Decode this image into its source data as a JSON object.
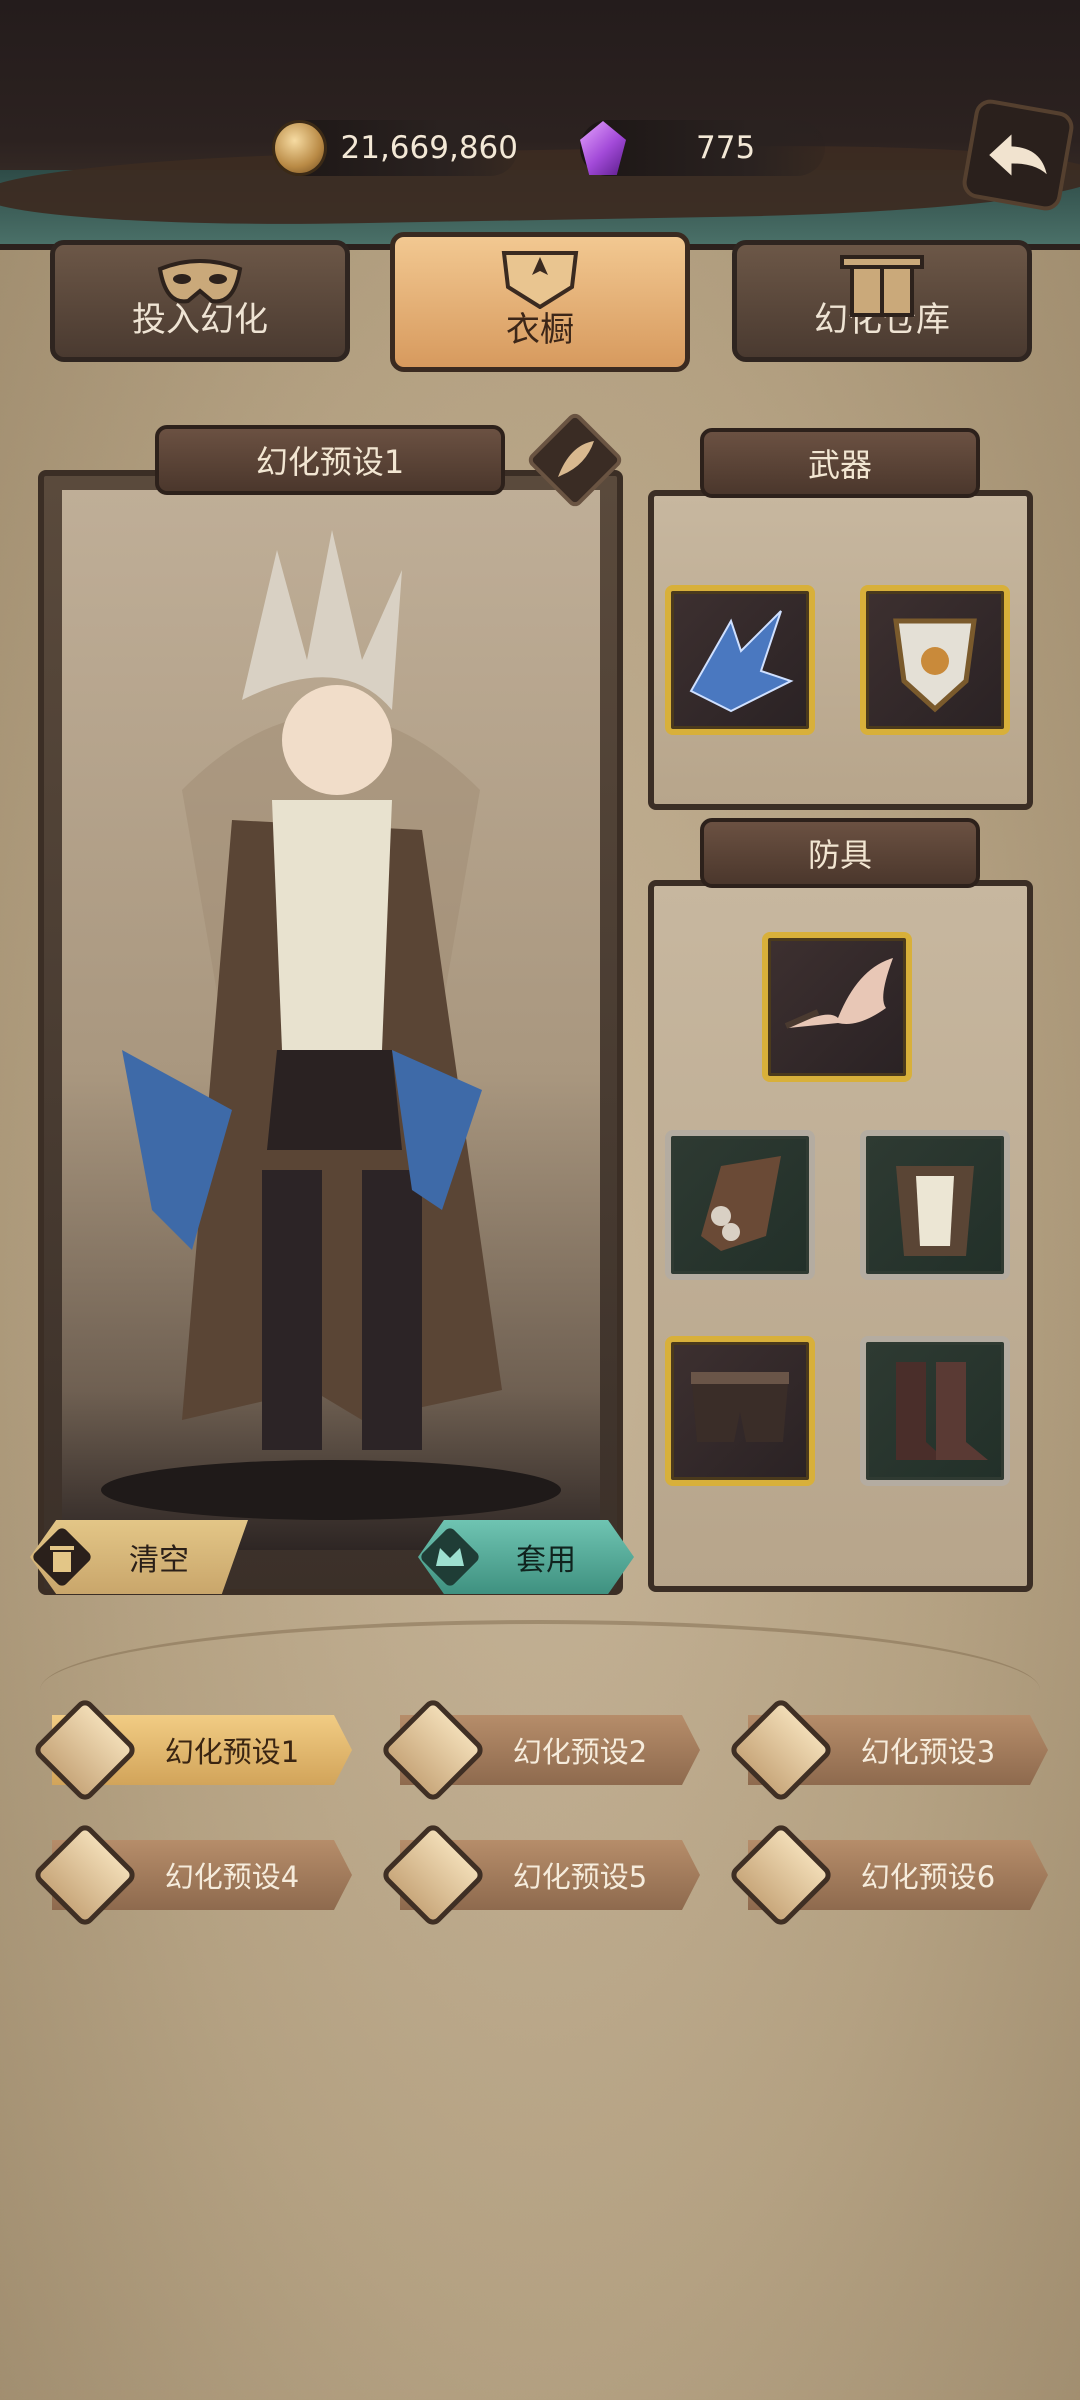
{
  "currency": {
    "gold": "21,669,860",
    "gems": "775"
  },
  "tabs": [
    {
      "label": "投入幻化",
      "active": false
    },
    {
      "label": "衣橱",
      "active": true
    },
    {
      "label": "幻化仓库",
      "active": false
    }
  ],
  "preview": {
    "title": "幻化预设1",
    "clear_label": "清空",
    "apply_label": "套用"
  },
  "equipment": {
    "weapon_title": "武器",
    "armor_title": "防具",
    "weapons": [
      "claw-weapon",
      "shield-weapon"
    ],
    "armor": [
      "wings",
      "gauntlets",
      "chest-armor",
      "shorts",
      "boots"
    ]
  },
  "presets": [
    {
      "label": "幻化预设1",
      "active": true
    },
    {
      "label": "幻化预设2",
      "active": false
    },
    {
      "label": "幻化预设3",
      "active": false
    },
    {
      "label": "幻化预设4",
      "active": false
    },
    {
      "label": "幻化预设5",
      "active": false
    },
    {
      "label": "幻化预设6",
      "active": false
    }
  ],
  "colors": {
    "accent_gold": "#d8b03a",
    "apply_teal": "#3f9180",
    "active_tab": "#f2c891"
  }
}
